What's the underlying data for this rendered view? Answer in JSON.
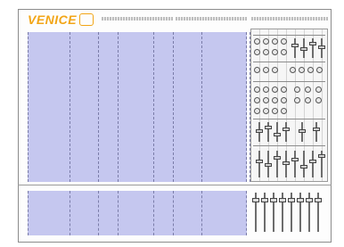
{
  "brand": {
    "logo_text": "VENICE"
  },
  "colors": {
    "channel_fill": "#c5c7ef",
    "logo": "#f2a516"
  },
  "upper_bank": {
    "channel_count": 8
  },
  "lower_bank": {
    "channel_count": 8
  },
  "master_section": {
    "fader_count": 8
  }
}
